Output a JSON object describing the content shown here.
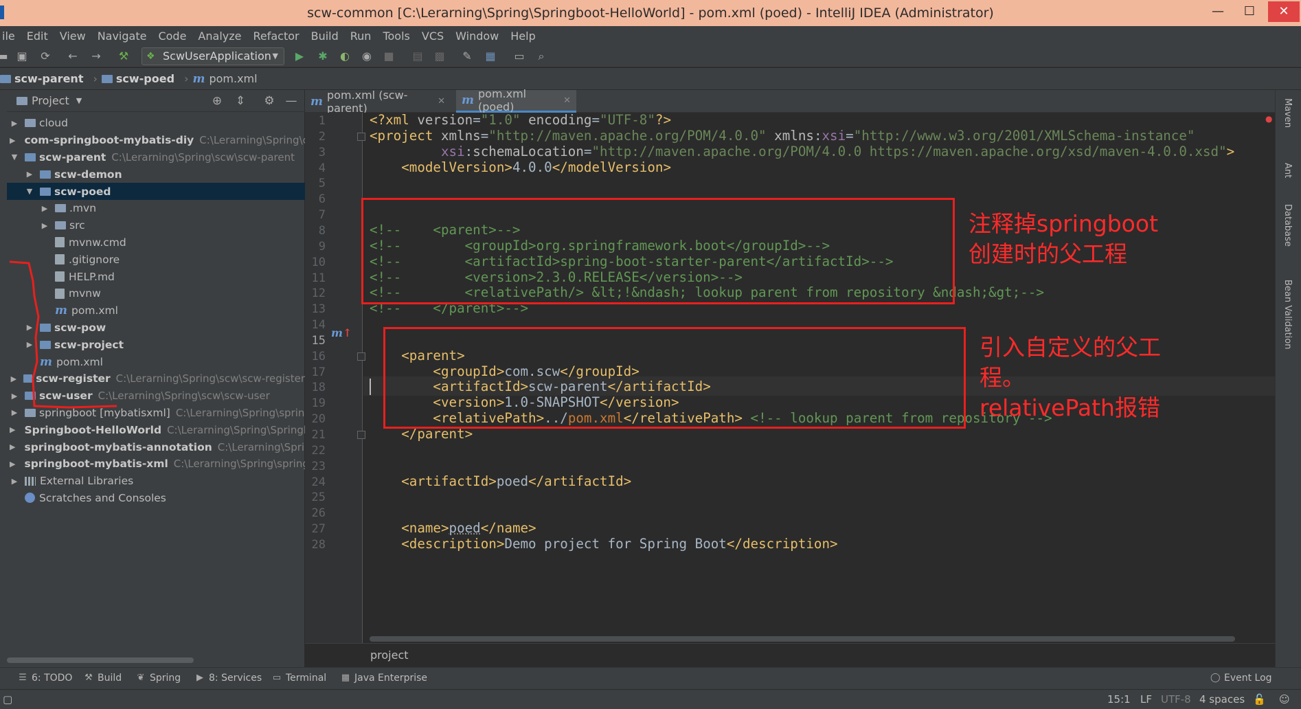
{
  "window": {
    "title": "scw-common [C:\\Lerarning\\Spring\\Springboot-HelloWorld] - pom.xml (poed) - IntelliJ IDEA (Administrator)",
    "minimize": "—",
    "maximize": "☐",
    "close": "✕"
  },
  "menu": [
    "ile",
    "Edit",
    "View",
    "Navigate",
    "Code",
    "Analyze",
    "Refactor",
    "Build",
    "Run",
    "Tools",
    "VCS",
    "Window",
    "Help"
  ],
  "toolbar": {
    "run_config": "ScwUserApplication"
  },
  "breadcrumb": [
    {
      "label": "scw-parent",
      "icon": "folder-icon"
    },
    {
      "label": "scw-poed",
      "icon": "folder-icon"
    },
    {
      "label": "pom.xml",
      "icon": "maven-icon"
    }
  ],
  "project_panel": {
    "title": "Project",
    "tree": [
      {
        "name": "cloud",
        "path": "",
        "arrow": "▶",
        "indent": 0,
        "icon": "folder",
        "bold": false
      },
      {
        "name": "com-springboot-mybatis-diy",
        "path": "C:\\Lerarning\\Spring\\c",
        "arrow": "▶",
        "indent": 0,
        "icon": "folder",
        "bold": true
      },
      {
        "name": "scw-parent",
        "path": "C:\\Lerarning\\Spring\\scw\\scw-parent",
        "arrow": "▼",
        "indent": 0,
        "icon": "folder",
        "bold": true
      },
      {
        "name": "scw-demon",
        "path": "",
        "arrow": "▶",
        "indent": 1,
        "icon": "folder",
        "bold": true
      },
      {
        "name": "scw-poed",
        "path": "",
        "arrow": "▼",
        "indent": 1,
        "icon": "folder",
        "bold": true,
        "selected": true
      },
      {
        "name": ".mvn",
        "path": "",
        "arrow": "▶",
        "indent": 2,
        "icon": "folder",
        "bold": false
      },
      {
        "name": "src",
        "path": "",
        "arrow": "▶",
        "indent": 2,
        "icon": "folder",
        "bold": false
      },
      {
        "name": "mvnw.cmd",
        "path": "",
        "arrow": "",
        "indent": 2,
        "icon": "file",
        "bold": false
      },
      {
        "name": ".gitignore",
        "path": "",
        "arrow": "",
        "indent": 2,
        "icon": "file",
        "bold": false
      },
      {
        "name": "HELP.md",
        "path": "",
        "arrow": "",
        "indent": 2,
        "icon": "file",
        "bold": false
      },
      {
        "name": "mvnw",
        "path": "",
        "arrow": "",
        "indent": 2,
        "icon": "file",
        "bold": false
      },
      {
        "name": "pom.xml",
        "path": "",
        "arrow": "",
        "indent": 2,
        "icon": "maven",
        "bold": false
      },
      {
        "name": "scw-pow",
        "path": "",
        "arrow": "▶",
        "indent": 1,
        "icon": "folder",
        "bold": true
      },
      {
        "name": "scw-project",
        "path": "",
        "arrow": "▶",
        "indent": 1,
        "icon": "folder",
        "bold": true
      },
      {
        "name": "pom.xml",
        "path": "",
        "arrow": "",
        "indent": 1,
        "icon": "maven",
        "bold": false
      },
      {
        "name": "scw-register",
        "path": "C:\\Lerarning\\Spring\\scw\\scw-register",
        "arrow": "▶",
        "indent": 0,
        "icon": "folder",
        "bold": true
      },
      {
        "name": "scw-user",
        "path": "C:\\Lerarning\\Spring\\scw\\scw-user",
        "arrow": "▶",
        "indent": 0,
        "icon": "folder",
        "bold": true
      },
      {
        "name": "springboot [mybatisxml]",
        "path": "C:\\Lerarning\\Spring\\sprin",
        "arrow": "▶",
        "indent": 0,
        "icon": "folder",
        "bold": false
      },
      {
        "name": "Springboot-HelloWorld",
        "path": "C:\\Lerarning\\Spring\\Springb",
        "arrow": "▶",
        "indent": 0,
        "icon": "folder",
        "bold": true
      },
      {
        "name": "springboot-mybatis-annotation",
        "path": "C:\\Lerarning\\Spring\\Sprin",
        "arrow": "▶",
        "indent": 0,
        "icon": "folder",
        "bold": true
      },
      {
        "name": "springboot-mybatis-xml",
        "path": "C:\\Lerarning\\Spring\\spring",
        "arrow": "▶",
        "indent": 0,
        "icon": "folder",
        "bold": true
      },
      {
        "name": "External Libraries",
        "path": "",
        "arrow": "▶",
        "indent": 0,
        "icon": "library",
        "bold": false
      },
      {
        "name": "Scratches and Consoles",
        "path": "",
        "arrow": "",
        "indent": 0,
        "icon": "scratch",
        "bold": false
      }
    ]
  },
  "tabs": [
    {
      "label": "pom.xml (scw-parent)",
      "active": false
    },
    {
      "label": "pom.xml (poed)",
      "active": true
    }
  ],
  "editor": {
    "line_numbers": [
      "1",
      "2",
      "3",
      "4",
      "5",
      "6",
      "7",
      "8",
      "9",
      "10",
      "11",
      "12",
      "13",
      "14",
      "15",
      "16",
      "17",
      "18",
      "19",
      "20",
      "21",
      "22",
      "23",
      "24",
      "25",
      "26",
      "27",
      "28"
    ],
    "current_line": "15",
    "annotations": {
      "box1": "注释掉springboot创建时的父工程",
      "box1_line1": "注释掉springboot",
      "box1_line2": "创建时的父工程",
      "box2_line1": "引入自定义的父工",
      "box2_line2": "程。",
      "box2_line3": "relativePath报错"
    },
    "path_crumb": "project"
  },
  "right_tools": [
    "Maven",
    "Ant",
    "Database",
    "Bean Validation"
  ],
  "bottom_tools": [
    "6: TODO",
    "Build",
    "Spring",
    "8: Services",
    "Terminal",
    "Java Enterprise",
    "Event Log"
  ],
  "status": {
    "position": "15:1",
    "line_sep": "LF",
    "encoding": "UTF-8",
    "indent": "4 spaces"
  },
  "colors": {
    "title_bar": "#f2b89c",
    "annotation_red": "#e8201e",
    "editor_bg": "#2b2b2b",
    "panel_bg": "#3c3f41"
  }
}
